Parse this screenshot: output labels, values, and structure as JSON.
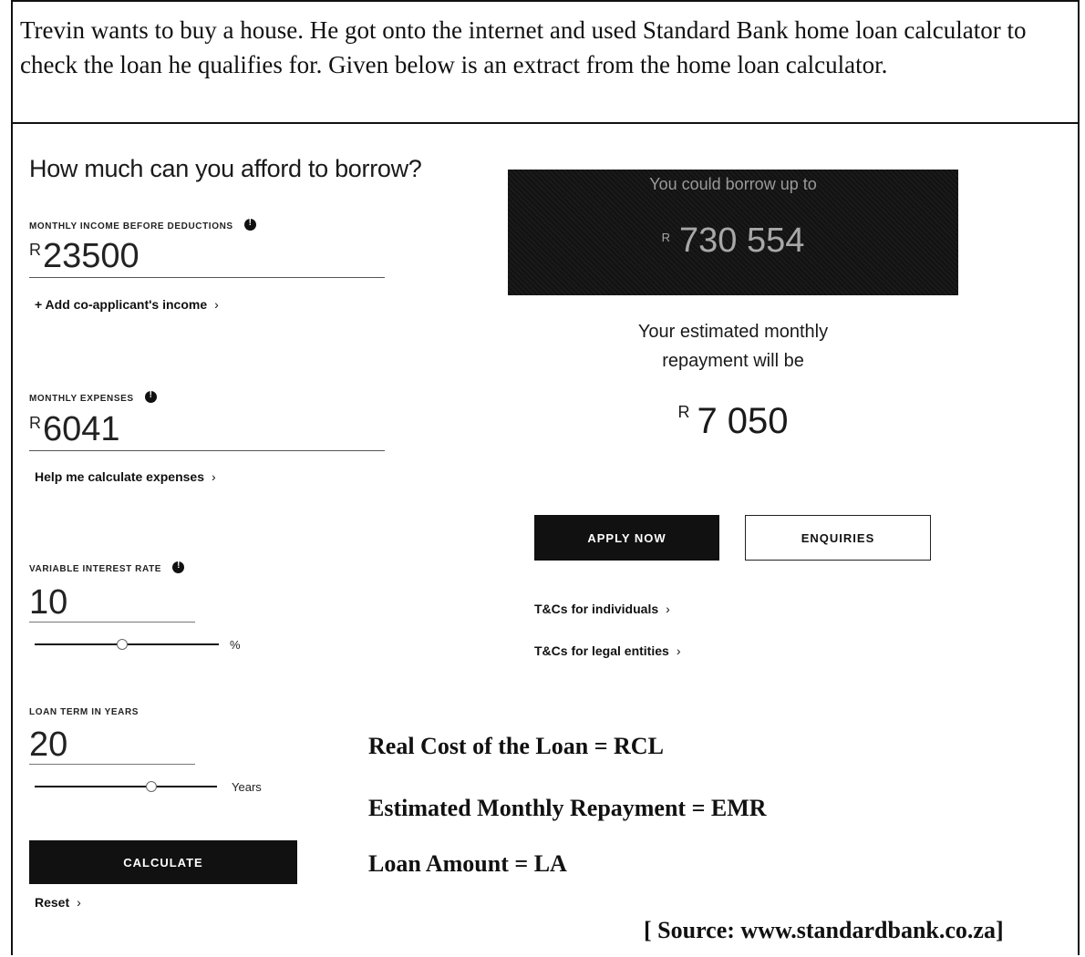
{
  "intro": "Trevin wants to buy a house. He got onto the internet and used Standard Bank home loan calculator to check the loan he qualifies for. Given below is an extract from the home loan calculator.",
  "calculator": {
    "heading": "How much can you afford to borrow?",
    "income": {
      "label": "MONTHLY INCOME BEFORE DEDUCTIONS",
      "currency": "R",
      "value": "23500",
      "link": "+ Add co-applicant's income",
      "chevron": "›"
    },
    "expenses": {
      "label": "MONTHLY EXPENSES",
      "currency": "R",
      "value": "6041",
      "link": "Help me calculate expenses",
      "chevron": "›"
    },
    "interest": {
      "label": "VARIABLE INTEREST RATE",
      "value": "10",
      "unit": "%"
    },
    "term": {
      "label": "LOAN TERM IN YEARS",
      "value": "20",
      "unit": "Years"
    },
    "calculate_label": "CALCULATE",
    "reset_label": "Reset",
    "reset_chevron": "›"
  },
  "result": {
    "borrow_title": "You could borrow up to",
    "borrow_currency": "R",
    "borrow_amount": "730 554",
    "estimate_text_1": "Your estimated monthly",
    "estimate_text_2": "repayment will be",
    "repay_currency": "R",
    "repay_amount": "7 050",
    "apply_label": "APPLY NOW",
    "enquiries_label": "ENQUIRIES",
    "tc_individuals": "T&Cs for individuals",
    "tc_legal": "T&Cs for legal entities",
    "chevron": "›"
  },
  "definitions": {
    "rcl": "Real Cost of the Loan = RCL",
    "emr": "Estimated Monthly Repayment = EMR",
    "la": "Loan Amount = LA"
  },
  "source": "[ Source: www.standardbank.co.za]"
}
